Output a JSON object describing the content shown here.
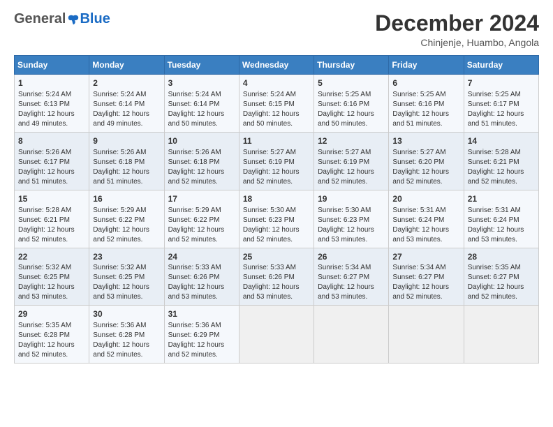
{
  "logo": {
    "general": "General",
    "blue": "Blue"
  },
  "header": {
    "month": "December 2024",
    "location": "Chinjenje, Huambo, Angola"
  },
  "days_of_week": [
    "Sunday",
    "Monday",
    "Tuesday",
    "Wednesday",
    "Thursday",
    "Friday",
    "Saturday"
  ],
  "weeks": [
    [
      {
        "day": "1",
        "sunrise": "Sunrise: 5:24 AM",
        "sunset": "Sunset: 6:13 PM",
        "daylight": "Daylight: 12 hours and 49 minutes."
      },
      {
        "day": "2",
        "sunrise": "Sunrise: 5:24 AM",
        "sunset": "Sunset: 6:14 PM",
        "daylight": "Daylight: 12 hours and 49 minutes."
      },
      {
        "day": "3",
        "sunrise": "Sunrise: 5:24 AM",
        "sunset": "Sunset: 6:14 PM",
        "daylight": "Daylight: 12 hours and 50 minutes."
      },
      {
        "day": "4",
        "sunrise": "Sunrise: 5:24 AM",
        "sunset": "Sunset: 6:15 PM",
        "daylight": "Daylight: 12 hours and 50 minutes."
      },
      {
        "day": "5",
        "sunrise": "Sunrise: 5:25 AM",
        "sunset": "Sunset: 6:16 PM",
        "daylight": "Daylight: 12 hours and 50 minutes."
      },
      {
        "day": "6",
        "sunrise": "Sunrise: 5:25 AM",
        "sunset": "Sunset: 6:16 PM",
        "daylight": "Daylight: 12 hours and 51 minutes."
      },
      {
        "day": "7",
        "sunrise": "Sunrise: 5:25 AM",
        "sunset": "Sunset: 6:17 PM",
        "daylight": "Daylight: 12 hours and 51 minutes."
      }
    ],
    [
      {
        "day": "8",
        "sunrise": "Sunrise: 5:26 AM",
        "sunset": "Sunset: 6:17 PM",
        "daylight": "Daylight: 12 hours and 51 minutes."
      },
      {
        "day": "9",
        "sunrise": "Sunrise: 5:26 AM",
        "sunset": "Sunset: 6:18 PM",
        "daylight": "Daylight: 12 hours and 51 minutes."
      },
      {
        "day": "10",
        "sunrise": "Sunrise: 5:26 AM",
        "sunset": "Sunset: 6:18 PM",
        "daylight": "Daylight: 12 hours and 52 minutes."
      },
      {
        "day": "11",
        "sunrise": "Sunrise: 5:27 AM",
        "sunset": "Sunset: 6:19 PM",
        "daylight": "Daylight: 12 hours and 52 minutes."
      },
      {
        "day": "12",
        "sunrise": "Sunrise: 5:27 AM",
        "sunset": "Sunset: 6:19 PM",
        "daylight": "Daylight: 12 hours and 52 minutes."
      },
      {
        "day": "13",
        "sunrise": "Sunrise: 5:27 AM",
        "sunset": "Sunset: 6:20 PM",
        "daylight": "Daylight: 12 hours and 52 minutes."
      },
      {
        "day": "14",
        "sunrise": "Sunrise: 5:28 AM",
        "sunset": "Sunset: 6:21 PM",
        "daylight": "Daylight: 12 hours and 52 minutes."
      }
    ],
    [
      {
        "day": "15",
        "sunrise": "Sunrise: 5:28 AM",
        "sunset": "Sunset: 6:21 PM",
        "daylight": "Daylight: 12 hours and 52 minutes."
      },
      {
        "day": "16",
        "sunrise": "Sunrise: 5:29 AM",
        "sunset": "Sunset: 6:22 PM",
        "daylight": "Daylight: 12 hours and 52 minutes."
      },
      {
        "day": "17",
        "sunrise": "Sunrise: 5:29 AM",
        "sunset": "Sunset: 6:22 PM",
        "daylight": "Daylight: 12 hours and 52 minutes."
      },
      {
        "day": "18",
        "sunrise": "Sunrise: 5:30 AM",
        "sunset": "Sunset: 6:23 PM",
        "daylight": "Daylight: 12 hours and 52 minutes."
      },
      {
        "day": "19",
        "sunrise": "Sunrise: 5:30 AM",
        "sunset": "Sunset: 6:23 PM",
        "daylight": "Daylight: 12 hours and 53 minutes."
      },
      {
        "day": "20",
        "sunrise": "Sunrise: 5:31 AM",
        "sunset": "Sunset: 6:24 PM",
        "daylight": "Daylight: 12 hours and 53 minutes."
      },
      {
        "day": "21",
        "sunrise": "Sunrise: 5:31 AM",
        "sunset": "Sunset: 6:24 PM",
        "daylight": "Daylight: 12 hours and 53 minutes."
      }
    ],
    [
      {
        "day": "22",
        "sunrise": "Sunrise: 5:32 AM",
        "sunset": "Sunset: 6:25 PM",
        "daylight": "Daylight: 12 hours and 53 minutes."
      },
      {
        "day": "23",
        "sunrise": "Sunrise: 5:32 AM",
        "sunset": "Sunset: 6:25 PM",
        "daylight": "Daylight: 12 hours and 53 minutes."
      },
      {
        "day": "24",
        "sunrise": "Sunrise: 5:33 AM",
        "sunset": "Sunset: 6:26 PM",
        "daylight": "Daylight: 12 hours and 53 minutes."
      },
      {
        "day": "25",
        "sunrise": "Sunrise: 5:33 AM",
        "sunset": "Sunset: 6:26 PM",
        "daylight": "Daylight: 12 hours and 53 minutes."
      },
      {
        "day": "26",
        "sunrise": "Sunrise: 5:34 AM",
        "sunset": "Sunset: 6:27 PM",
        "daylight": "Daylight: 12 hours and 53 minutes."
      },
      {
        "day": "27",
        "sunrise": "Sunrise: 5:34 AM",
        "sunset": "Sunset: 6:27 PM",
        "daylight": "Daylight: 12 hours and 52 minutes."
      },
      {
        "day": "28",
        "sunrise": "Sunrise: 5:35 AM",
        "sunset": "Sunset: 6:27 PM",
        "daylight": "Daylight: 12 hours and 52 minutes."
      }
    ],
    [
      {
        "day": "29",
        "sunrise": "Sunrise: 5:35 AM",
        "sunset": "Sunset: 6:28 PM",
        "daylight": "Daylight: 12 hours and 52 minutes."
      },
      {
        "day": "30",
        "sunrise": "Sunrise: 5:36 AM",
        "sunset": "Sunset: 6:28 PM",
        "daylight": "Daylight: 12 hours and 52 minutes."
      },
      {
        "day": "31",
        "sunrise": "Sunrise: 5:36 AM",
        "sunset": "Sunset: 6:29 PM",
        "daylight": "Daylight: 12 hours and 52 minutes."
      },
      null,
      null,
      null,
      null
    ]
  ]
}
